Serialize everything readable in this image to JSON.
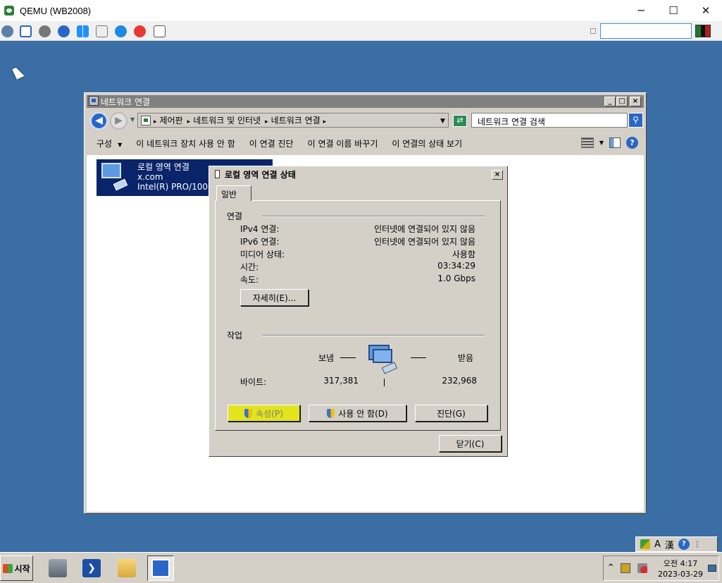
{
  "host": {
    "title": "QEMU (WB2008)",
    "controls": {
      "minimize": "─",
      "maximize": "☐",
      "close": "✕"
    },
    "toolbar_icons": [
      "network-icon",
      "fullscreen-icon",
      "settings-icon",
      "refresh-icon",
      "windows-icon",
      "clipboard-icon",
      "info-icon",
      "stop-icon",
      "snapshot-icon"
    ]
  },
  "window": {
    "title": "네트워크 연결",
    "buttons": {
      "minimize": "_",
      "maximize": "□",
      "close": "×"
    },
    "breadcrumb": [
      "제어판",
      "네트워크 및 인터넷",
      "네트워크 연결"
    ],
    "search_placeholder": "네트워크 연결 검색",
    "commands": {
      "organize": "구성",
      "disable": "이 네트워크 장치 사용 안 함",
      "diagnose": "이 연결 진단",
      "rename": "이 연결 이름 바꾸기",
      "status": "이 연결의 상태 보기"
    },
    "connection": {
      "name": "로컬 영역 연결",
      "domain": "x.com",
      "adapter": "Intel(R) PRO/1000"
    }
  },
  "dialog": {
    "title": "로컬 영역 연결 상태",
    "close": "×",
    "tab": "일반",
    "connection_group": "연결",
    "rows": [
      {
        "label": "IPv4 연결:",
        "value": "인터넷에 연결되어 있지 않음"
      },
      {
        "label": "IPv6 연결:",
        "value": "인터넷에 연결되어 있지 않음"
      },
      {
        "label": "미디어 상태:",
        "value": "사용함"
      },
      {
        "label": "시간:",
        "value": "03:34:29"
      },
      {
        "label": "속도:",
        "value": "1.0 Gbps"
      }
    ],
    "details_button": "자세히(E)...",
    "activity_group": "작업",
    "sent_label": "보냄",
    "received_label": "받음",
    "bytes_label": "바이트:",
    "bytes_sent": "317,381",
    "bytes_received": "232,968",
    "properties_button": "속성(P)",
    "disable_button": "사용 안 함(D)",
    "diagnose_button": "진단(G)",
    "close_button": "닫기(C)"
  },
  "taskbar": {
    "start": "시작",
    "language_bar": {
      "ime_a": "A",
      "ime_han": "漢",
      "help": "?"
    },
    "clock_time": "오전 4:17",
    "clock_date": "2023-03-29"
  },
  "colors": {
    "desktop": "#3a6ea5",
    "selection": "#0a246a",
    "highlight_button": "#e2e41e"
  }
}
